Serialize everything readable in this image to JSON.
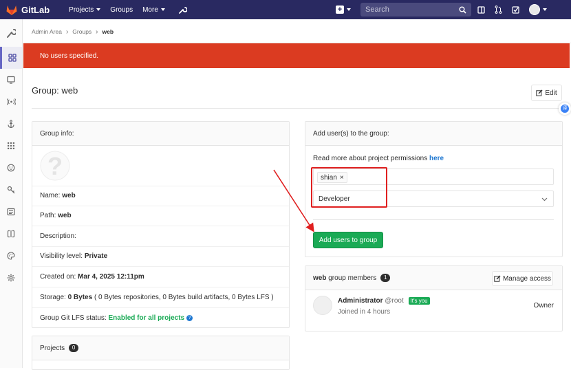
{
  "topnav": {
    "brand": "GitLab",
    "links": [
      "Projects",
      "Groups",
      "More"
    ],
    "search_placeholder": "Search"
  },
  "breadcrumb": [
    "Admin Area",
    "Groups",
    "web"
  ],
  "flash": "No users specified.",
  "page_title": "Group: web",
  "edit_label": "Edit",
  "group_info": {
    "heading": "Group info:",
    "name_label": "Name:",
    "name_value": "web",
    "path_label": "Path:",
    "path_value": "web",
    "description_label": "Description:",
    "visibility_label": "Visibility level:",
    "visibility_value": "Private",
    "created_label": "Created on:",
    "created_value": "Mar 4, 2025 12:11pm",
    "storage_label": "Storage:",
    "storage_value": "0 Bytes",
    "storage_detail": "( 0 Bytes repositories, 0 Bytes build artifacts, 0 Bytes LFS )",
    "lfs_label": "Group Git LFS status:",
    "lfs_value": "Enabled for all projects"
  },
  "projects": {
    "heading": "Projects",
    "count": "0"
  },
  "add_users": {
    "heading": "Add user(s) to the group:",
    "permissions_text": "Read more about project permissions",
    "permissions_link": "here",
    "token": "shian",
    "role": "Developer",
    "submit": "Add users to group"
  },
  "members": {
    "group_name": "web",
    "heading_suffix": "group members",
    "count": "1",
    "manage_label": "Manage access",
    "member_name": "Administrator",
    "member_handle": "@root",
    "member_badge": "It's you",
    "member_joined": "Joined in 4 hours",
    "member_role": "Owner"
  },
  "colors": {
    "nav": "#292961",
    "flash": "#db3b21",
    "success": "#1aaa55",
    "annotation": "#e02020"
  }
}
